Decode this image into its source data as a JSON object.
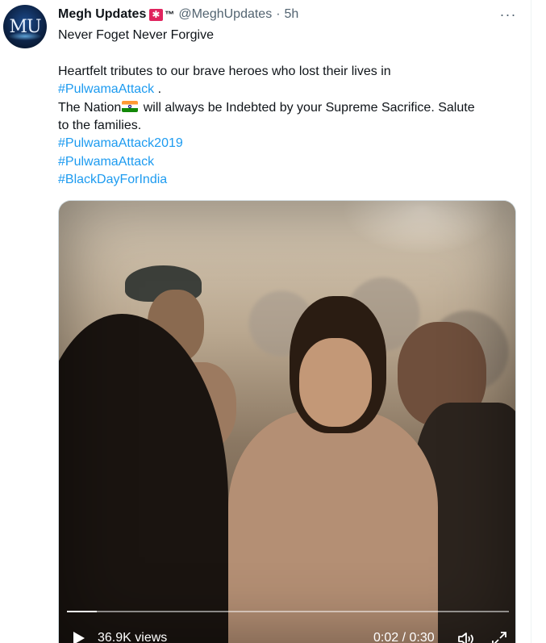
{
  "tweet": {
    "avatar_initials": "MU",
    "author_name": "Megh Updates",
    "author_badge_icon": "rotating-light-emoji",
    "author_badge_tm": "™",
    "handle": "@MeghUpdates",
    "separator": "·",
    "time": "5h",
    "more_icon": "more-horizontal-icon",
    "more_label": "···",
    "text": {
      "line1": "Never Foget Never Forgive",
      "line2": "Heartfelt tributes to our brave heroes who lost their lives in",
      "hashtag1": "#PulwamaAttack",
      "line3_suffix": " .",
      "line4_prefix": "The Nation",
      "flag_icon": "india-flag-emoji",
      "line4_suffix": " will always be Indebted by your Supreme Sacrifice. Salute",
      "line5": "to the families.",
      "hashtag2": "#PulwamaAttack2019",
      "hashtag3": "#PulwamaAttack",
      "hashtag4": "#BlackDayForIndia"
    }
  },
  "video": {
    "views": "36.9K views",
    "current_time": "0:02",
    "duration": "0:30",
    "time_display": "0:02 / 0:30",
    "progress_fraction": 0.0667,
    "play_icon": "play-icon",
    "volume_icon": "volume-icon",
    "expand_icon": "fullscreen-expand-icon"
  },
  "colors": {
    "link": "#1d9bf0",
    "secondary_text": "#536471",
    "primary_text": "#0f1419"
  }
}
